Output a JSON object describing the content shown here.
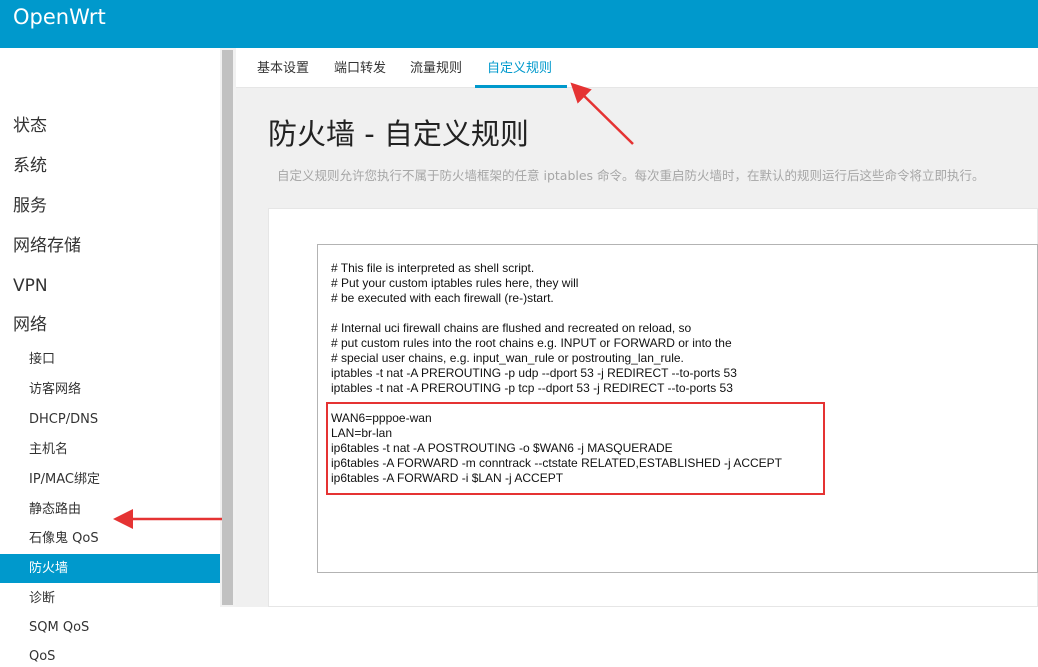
{
  "header": {
    "brand": "OpenWrt"
  },
  "sidebar": {
    "top_items": [
      "状态",
      "系统",
      "服务",
      "网络存储",
      "VPN",
      "网络"
    ],
    "sub_items": [
      "接口",
      "访客网络",
      "DHCP/DNS",
      "主机名",
      "IP/MAC绑定",
      "静态路由",
      "石像鬼 QoS",
      "防火墙",
      "诊断",
      "SQM QoS",
      "QoS"
    ],
    "active_sub_item": "防火墙"
  },
  "tabs": [
    "基本设置",
    "端口转发",
    "流量规则",
    "自定义规则"
  ],
  "active_tab": "自定义规则",
  "page": {
    "title": "防火墙 - 自定义规则",
    "description": "自定义规则允许您执行不属于防火墙框架的任意 iptables 命令。每次重启防火墙时，在默认的规则运行后这些命令将立即执行。"
  },
  "editor": {
    "lines": [
      "# This file is interpreted as shell script.",
      "# Put your custom iptables rules here, they will",
      "# be executed with each firewall (re-)start.",
      "",
      "# Internal uci firewall chains are flushed and recreated on reload, so",
      "# put custom rules into the root chains e.g. INPUT or FORWARD or into the",
      "# special user chains, e.g. input_wan_rule or postrouting_lan_rule.",
      "iptables -t nat -A PREROUTING -p udp --dport 53 -j REDIRECT --to-ports 53",
      "iptables -t nat -A PREROUTING -p tcp --dport 53 -j REDIRECT --to-ports 53",
      "",
      "WAN6=pppoe-wan",
      "LAN=br-lan",
      "ip6tables -t nat -A POSTROUTING -o $WAN6 -j MASQUERADE",
      "ip6tables -A FORWARD -m conntrack --ctstate RELATED,ESTABLISHED -j ACCEPT",
      "ip6tables -A FORWARD -i $LAN -j ACCEPT"
    ]
  },
  "colors": {
    "accent": "#0099cc",
    "annotation": "#e53333"
  }
}
